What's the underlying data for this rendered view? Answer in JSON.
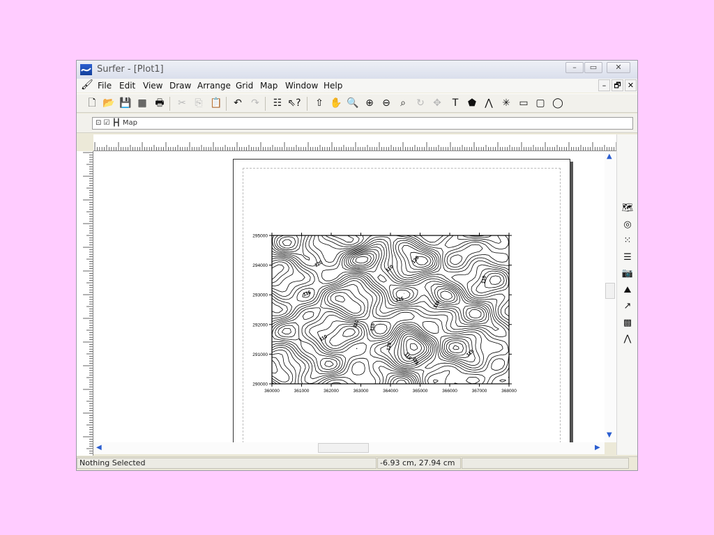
{
  "window": {
    "title": "Surfer - [Plot1]",
    "controls": {
      "minimize": "–",
      "restore": "▭",
      "close": "✕"
    },
    "mdi_controls": {
      "minimize": "–",
      "restore": "🗗",
      "close": "✕"
    }
  },
  "menu": [
    "File",
    "Edit",
    "View",
    "Draw",
    "Arrange",
    "Grid",
    "Map",
    "Window",
    "Help"
  ],
  "toolbar": [
    {
      "name": "new-icon",
      "glyph": "🗋"
    },
    {
      "name": "open-icon",
      "glyph": "📂"
    },
    {
      "name": "save-icon",
      "glyph": "💾"
    },
    {
      "name": "worksheet-icon",
      "glyph": "▦"
    },
    {
      "name": "print-icon",
      "glyph": "🖶"
    },
    {
      "name": "cut-icon",
      "glyph": "✂"
    },
    {
      "name": "copy-icon",
      "glyph": "⎘"
    },
    {
      "name": "paste-icon",
      "glyph": "📋"
    },
    {
      "name": "undo-icon",
      "glyph": "↶"
    },
    {
      "name": "redo-icon",
      "glyph": "↷"
    },
    {
      "name": "object-manager-icon",
      "glyph": "☷"
    },
    {
      "name": "help-pointer-icon",
      "glyph": "⇖?"
    },
    {
      "name": "select-icon",
      "glyph": "⇧"
    },
    {
      "name": "pan-icon",
      "glyph": "✋"
    },
    {
      "name": "zoom-realtime-icon",
      "glyph": "🔍"
    },
    {
      "name": "zoom-in-icon",
      "glyph": "⊕"
    },
    {
      "name": "zoom-out-icon",
      "glyph": "⊖"
    },
    {
      "name": "zoom-rectangle-icon",
      "glyph": "⌕"
    },
    {
      "name": "rotate-icon",
      "glyph": "↻"
    },
    {
      "name": "reshape-icon",
      "glyph": "✥"
    },
    {
      "name": "text-icon",
      "glyph": "T"
    },
    {
      "name": "polygon-icon",
      "glyph": "⬟"
    },
    {
      "name": "polyline-icon",
      "glyph": "⋀"
    },
    {
      "name": "symbol-icon",
      "glyph": "✳"
    },
    {
      "name": "rectangle-icon",
      "glyph": "▭"
    },
    {
      "name": "rounded-rectangle-icon",
      "glyph": "▢"
    },
    {
      "name": "ellipse-icon",
      "glyph": "◯"
    }
  ],
  "toolbar2": {
    "combo_value": "⊡ ☑ ┣┫ Map"
  },
  "map_tools": [
    {
      "name": "base-map-icon",
      "glyph": "🗺"
    },
    {
      "name": "contour-map-icon",
      "glyph": "◎"
    },
    {
      "name": "post-map-icon",
      "glyph": "⁙"
    },
    {
      "name": "classed-post-map-icon",
      "glyph": "☰"
    },
    {
      "name": "image-map-icon",
      "glyph": "📷"
    },
    {
      "name": "shaded-relief-map-icon",
      "glyph": "⛰"
    },
    {
      "name": "vector-map-icon",
      "glyph": "↗"
    },
    {
      "name": "wireframe-icon",
      "glyph": "▩"
    },
    {
      "name": "surface-icon",
      "glyph": "⋀"
    }
  ],
  "map": {
    "y_ticks": [
      "295000",
      "294000",
      "293000",
      "292000",
      "291000",
      "290000"
    ],
    "x_ticks": [
      "360000",
      "361000",
      "362000",
      "363000",
      "364000",
      "365000",
      "366000",
      "367000",
      "368000"
    ],
    "contour_labels": [
      "120",
      "110",
      "120",
      "110",
      "115",
      "110",
      "115",
      "110",
      "120",
      "110",
      "115",
      "115",
      "110",
      "115"
    ]
  },
  "status": {
    "selection": "Nothing Selected",
    "coordinates": "-6.93 cm, 27.94 cm",
    "extra": ""
  }
}
